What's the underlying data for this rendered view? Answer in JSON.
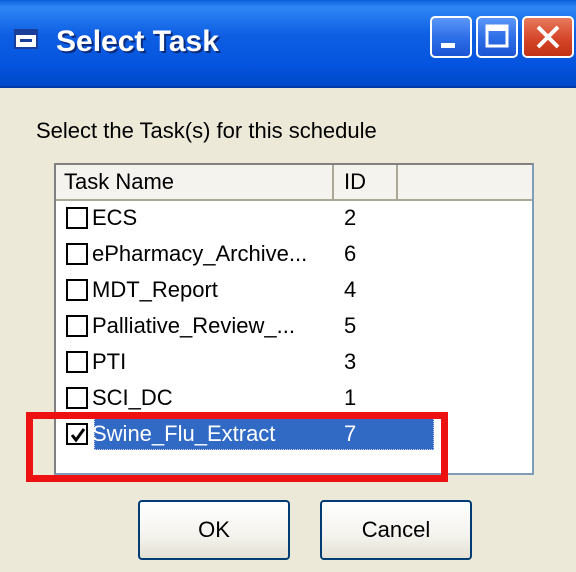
{
  "window": {
    "title": "Select Task"
  },
  "prompt": "Select the Task(s) for this schedule",
  "list": {
    "columns": [
      "Task Name",
      "ID"
    ],
    "rows": [
      {
        "name": "ECS",
        "id": "2",
        "checked": false
      },
      {
        "name": "ePharmacy_Archive...",
        "id": "6",
        "checked": false
      },
      {
        "name": "MDT_Report",
        "id": "4",
        "checked": false
      },
      {
        "name": "Palliative_Review_...",
        "id": "5",
        "checked": false
      },
      {
        "name": "PTI",
        "id": "3",
        "checked": false
      },
      {
        "name": "SCI_DC",
        "id": "1",
        "checked": false
      },
      {
        "name": "Swine_Flu_Extract",
        "id": "7",
        "checked": true,
        "selected": true
      }
    ]
  },
  "buttons": {
    "ok": "OK",
    "cancel": "Cancel"
  },
  "colors": {
    "titlebar": "#0554df",
    "selection": "#316ac5",
    "highlight": "#ee1111"
  }
}
